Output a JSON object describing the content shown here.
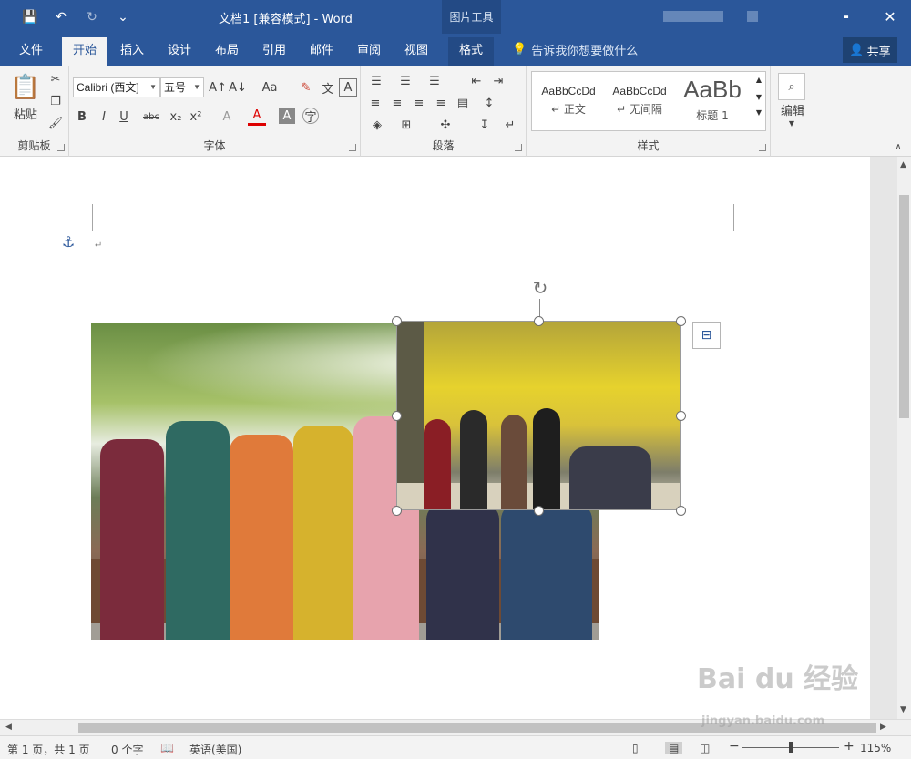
{
  "titlebar": {
    "title": "文档1 [兼容模式] - Word",
    "contextual_tab_group": "图片工具",
    "minimize_glyph": "╸",
    "close_glyph": "✕"
  },
  "qat": {
    "save": "💾",
    "undo": "↶",
    "redo": "↻",
    "customize": "⌄"
  },
  "tabs": [
    "文件",
    "开始",
    "插入",
    "设计",
    "布局",
    "引用",
    "邮件",
    "审阅",
    "视图",
    "格式"
  ],
  "active_tab": "开始",
  "tell_me": "告诉我你想要做什么",
  "share": "共享",
  "ribbon": {
    "clipboard": {
      "paste": "粘贴",
      "label": "剪贴板"
    },
    "font": {
      "font_name": "Calibri (西文]",
      "font_size": "五号",
      "label": "字体",
      "bold": "B",
      "italic": "I",
      "underline": "U",
      "strike": "abc",
      "sub": "x₂",
      "sup": "x²",
      "color_a": "A"
    },
    "paragraph": {
      "label": "段落"
    },
    "styles": {
      "label": "样式",
      "items": [
        {
          "sample": "AaBbCcDd",
          "name": "↵ 正文"
        },
        {
          "sample": "AaBbCcDd",
          "name": "↵ 无间隔"
        },
        {
          "sample": "AaBb",
          "name": "标题 1"
        }
      ]
    },
    "editing": {
      "label": "编辑"
    }
  },
  "status": {
    "page": "第 1 页，共 1 页",
    "words": "0 个字",
    "language": "英语(美国)",
    "zoom": "115%"
  },
  "watermark": {
    "logo": "Bai du 经验",
    "url": "jingyan.baidu.com"
  }
}
